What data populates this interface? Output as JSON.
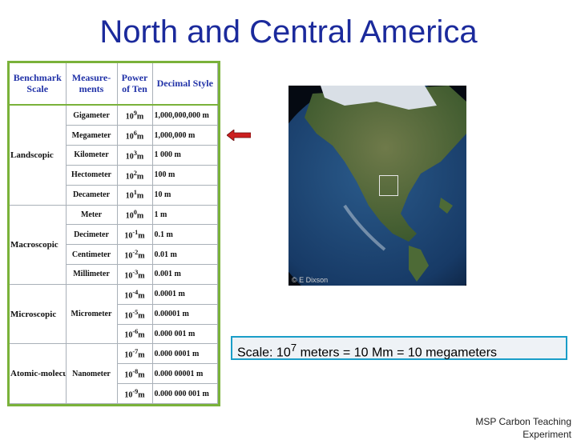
{
  "title": "North and Central America",
  "table": {
    "headers": {
      "scale": "Benchmark Scale",
      "measure": "Measure-ments",
      "power": "Power of Ten",
      "decimal": "Decimal Style"
    },
    "categories": {
      "landscopic": "Landscopic",
      "macroscopic": "Macroscopic",
      "microscopic": "Microscopic",
      "atomic": "Atomic-molecular"
    },
    "rows": [
      {
        "unit": "Gigameter",
        "base": "10",
        "exp": "9",
        "suffix": "m",
        "decimal": "1,000,000,000 m"
      },
      {
        "unit": "Megameter",
        "base": "10",
        "exp": "6",
        "suffix": "m",
        "decimal": "1,000,000 m"
      },
      {
        "unit": "Kilometer",
        "base": "10",
        "exp": "3",
        "suffix": "m",
        "decimal": "1 000 m"
      },
      {
        "unit": "Hectometer",
        "base": "10",
        "exp": "2",
        "suffix": "m",
        "decimal": "100 m"
      },
      {
        "unit": "Decameter",
        "base": "10",
        "exp": "1",
        "suffix": "m",
        "decimal": "10 m"
      },
      {
        "unit": "Meter",
        "base": "10",
        "exp": "0",
        "suffix": "m",
        "decimal": "1 m"
      },
      {
        "unit": "Decimeter",
        "base": "10",
        "exp": "-1",
        "suffix": "m",
        "decimal": "0.1 m"
      },
      {
        "unit": "Centimeter",
        "base": "10",
        "exp": "-2",
        "suffix": "m",
        "decimal": "0.01 m"
      },
      {
        "unit": "Millimeter",
        "base": "10",
        "exp": "-3",
        "suffix": "m",
        "decimal": "0.001 m"
      },
      {
        "unit": "",
        "base": "10",
        "exp": "-4",
        "suffix": "m",
        "decimal": "0.0001 m"
      },
      {
        "unit": "Micrometer",
        "base": "10",
        "exp": "-5",
        "suffix": "m",
        "decimal": "0.00001 m"
      },
      {
        "unit": "",
        "base": "10",
        "exp": "-6",
        "suffix": "m",
        "decimal": "0.000 001 m"
      },
      {
        "unit": "",
        "base": "10",
        "exp": "-7",
        "suffix": "m",
        "decimal": "0.000 0001 m"
      },
      {
        "unit": "Nanometer",
        "base": "10",
        "exp": "-8",
        "suffix": "m",
        "decimal": "0.000 00001 m"
      },
      {
        "unit": "",
        "base": "10",
        "exp": "-9",
        "suffix": "m",
        "decimal": "0.000 000 001 m"
      }
    ]
  },
  "image": {
    "credit": "© E Dixson"
  },
  "scale": {
    "prefix": "Scale: 10",
    "exp": "7",
    "rest": " meters = 10 Mm = 10 megameters"
  },
  "footer": {
    "line1": "MSP Carbon Teaching",
    "line2": "Experiment"
  },
  "colors": {
    "title": "#1b2a9c",
    "frame": "#7ab23a",
    "arrow": "#cc1f1f",
    "scale_border": "#1a9dc8"
  }
}
